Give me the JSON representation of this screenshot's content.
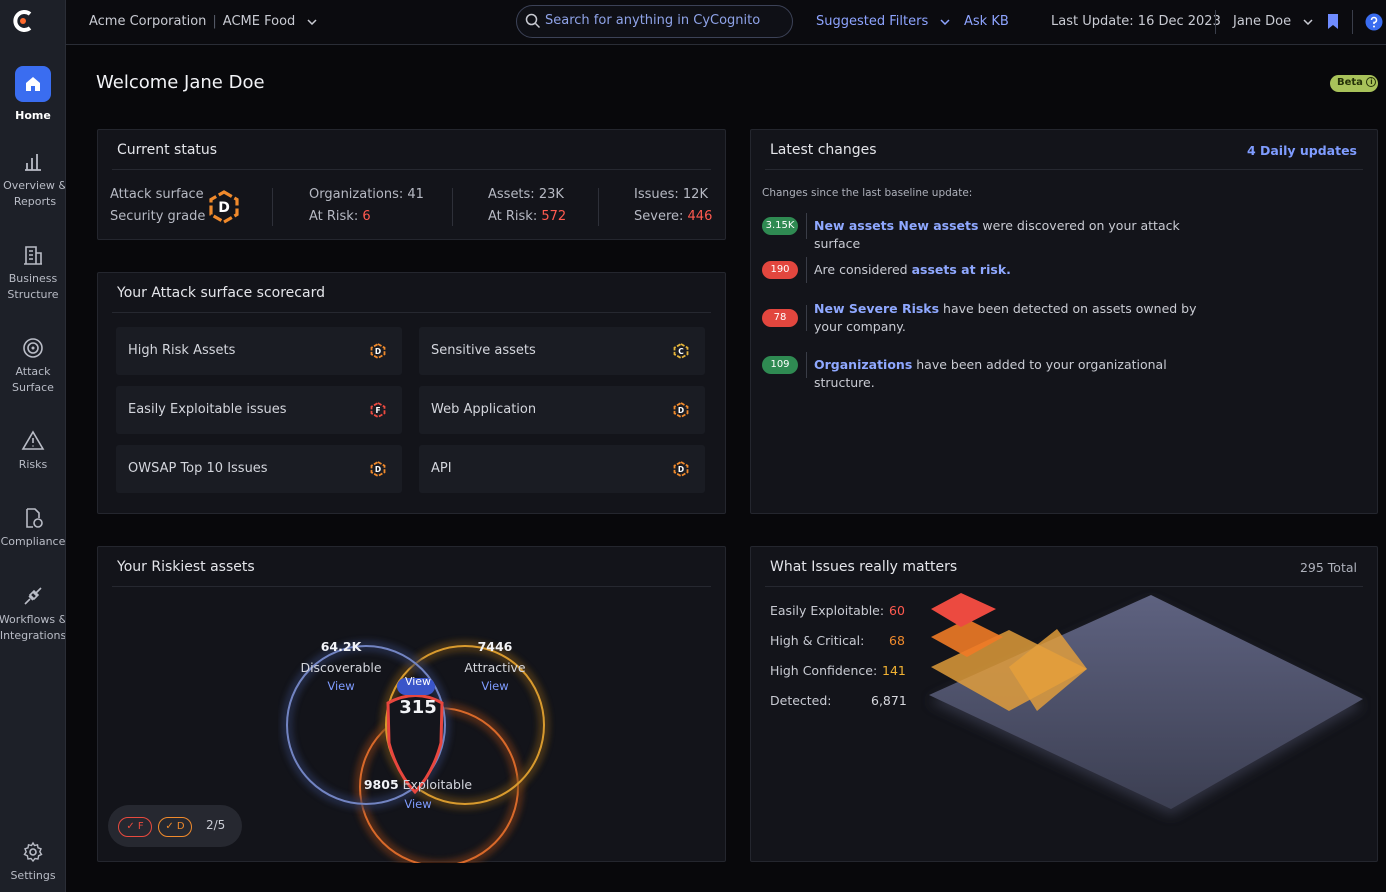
{
  "sidebar": {
    "items": [
      {
        "label": "Home",
        "icon": "home-icon"
      },
      {
        "label": "Overview & Reports",
        "icon": "bar-chart-icon"
      },
      {
        "label": "Business Structure",
        "icon": "building-icon"
      },
      {
        "label": "Attack Surface",
        "icon": "radar-icon"
      },
      {
        "label": "Risks",
        "icon": "warning-icon"
      },
      {
        "label": "Compliance",
        "icon": "document-check-icon"
      },
      {
        "label": "Workflows & Integrations",
        "icon": "plug-icon"
      },
      {
        "label": "Settings",
        "icon": "gear-icon"
      }
    ]
  },
  "topbar": {
    "org": "Acme Corporation",
    "sub_org": "ACME Food",
    "search_placeholder": "Search for anything in CyCognito",
    "suggested_filters": "Suggested Filters",
    "ask_kb": "Ask KB",
    "last_update": "Last Update: 16 Dec 2023",
    "user": "Jane Doe"
  },
  "welcome": "Welcome Jane Doe",
  "beta": "Beta",
  "current_status": {
    "title": "Current status",
    "grade_label_1": "Attack surface",
    "grade_label_2": "Security grade",
    "grade": "D",
    "organizations": "Organizations: 41",
    "org_at_risk_label": "At Risk:",
    "org_at_risk": "6",
    "assets": "Assets: 23K",
    "assets_at_risk_label": "At Risk:",
    "assets_at_risk": "572",
    "issues": "Issues: 12K",
    "severe_label": "Severe:",
    "severe": "446"
  },
  "scorecard": {
    "title": "Your Attack surface scorecard",
    "items": [
      {
        "label": "High Risk Assets",
        "grade": "D"
      },
      {
        "label": "Sensitive assets",
        "grade": "C"
      },
      {
        "label": "Easily Exploitable issues",
        "grade": "F"
      },
      {
        "label": "Web Application",
        "grade": "D"
      },
      {
        "label": "OWSAP Top 10 Issues",
        "grade": "D"
      },
      {
        "label": "API",
        "grade": "D"
      }
    ]
  },
  "latest_changes": {
    "title": "Latest changes",
    "daily": "4 Daily updates",
    "subtitle": "Changes since the last baseline update:",
    "rows": [
      {
        "count": "3.15K",
        "hl": "New assets New assets",
        "text": " were discovered on your attack surface",
        "color": "#2f8a52"
      },
      {
        "count": "190",
        "pre": "Are considered ",
        "hl": "assets at risk.",
        "text": "",
        "color": "#e2463e"
      },
      {
        "count": "78",
        "hl": "New Severe Risks",
        "text": " have been detected on assets owned by your company.",
        "color": "#e2463e"
      },
      {
        "count": "109",
        "hl": "Organizations",
        "text": " have been added to your organizational structure.",
        "color": "#2f8a52"
      }
    ]
  },
  "riskiest": {
    "title": "Your Riskiest assets",
    "discoverable_num": "64.2K",
    "discoverable_label": "Discoverable",
    "attractive_num": "7446",
    "attractive_label": "Attractive",
    "exploitable_num": "9805",
    "exploitable_label": "Exploitable",
    "center_num": "315",
    "view": "View",
    "filters": [
      "F",
      "D"
    ],
    "page": "2/5"
  },
  "issues_matter": {
    "title": "What Issues really matters",
    "total": "295 Total",
    "rows": [
      {
        "label": "Easily Exploitable:",
        "value": "60",
        "color": "#ff5a4f"
      },
      {
        "label": "High & Critical:",
        "value": "68",
        "color": "#f08a2c"
      },
      {
        "label": "High Confidence:",
        "value": "141",
        "color": "#f2b233"
      },
      {
        "label": "Detected:",
        "value": "6,871",
        "color": "#d7d8de"
      }
    ]
  }
}
